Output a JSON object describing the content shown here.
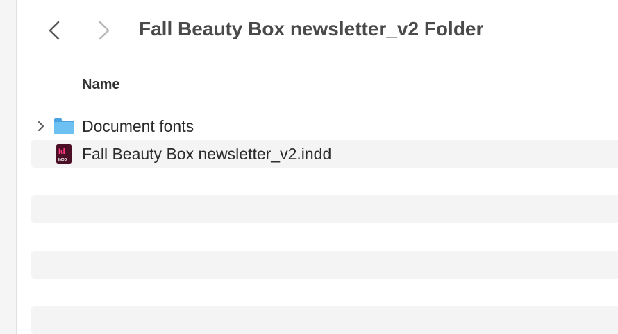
{
  "toolbar": {
    "back_icon": "chevron-left-icon",
    "forward_icon": "chevron-right-icon",
    "title": "Fall Beauty Box newsletter_v2 Folder"
  },
  "columns": {
    "name_header": "Name"
  },
  "files": [
    {
      "name": "Document fonts",
      "kind": "folder",
      "icon": "folder-icon",
      "expandable": true
    },
    {
      "name": "Fall Beauty Box newsletter_v2.indd",
      "kind": "indesign-document",
      "icon": "indesign-file-icon",
      "icon_label": "Id",
      "icon_sublabel": "INDD",
      "expandable": false
    }
  ],
  "colors": {
    "folder_blue": "#5ab4ec",
    "indesign_dark": "#4a0f25",
    "indesign_pink": "#ff3c7a",
    "alt_row": "#f4f4f4"
  }
}
